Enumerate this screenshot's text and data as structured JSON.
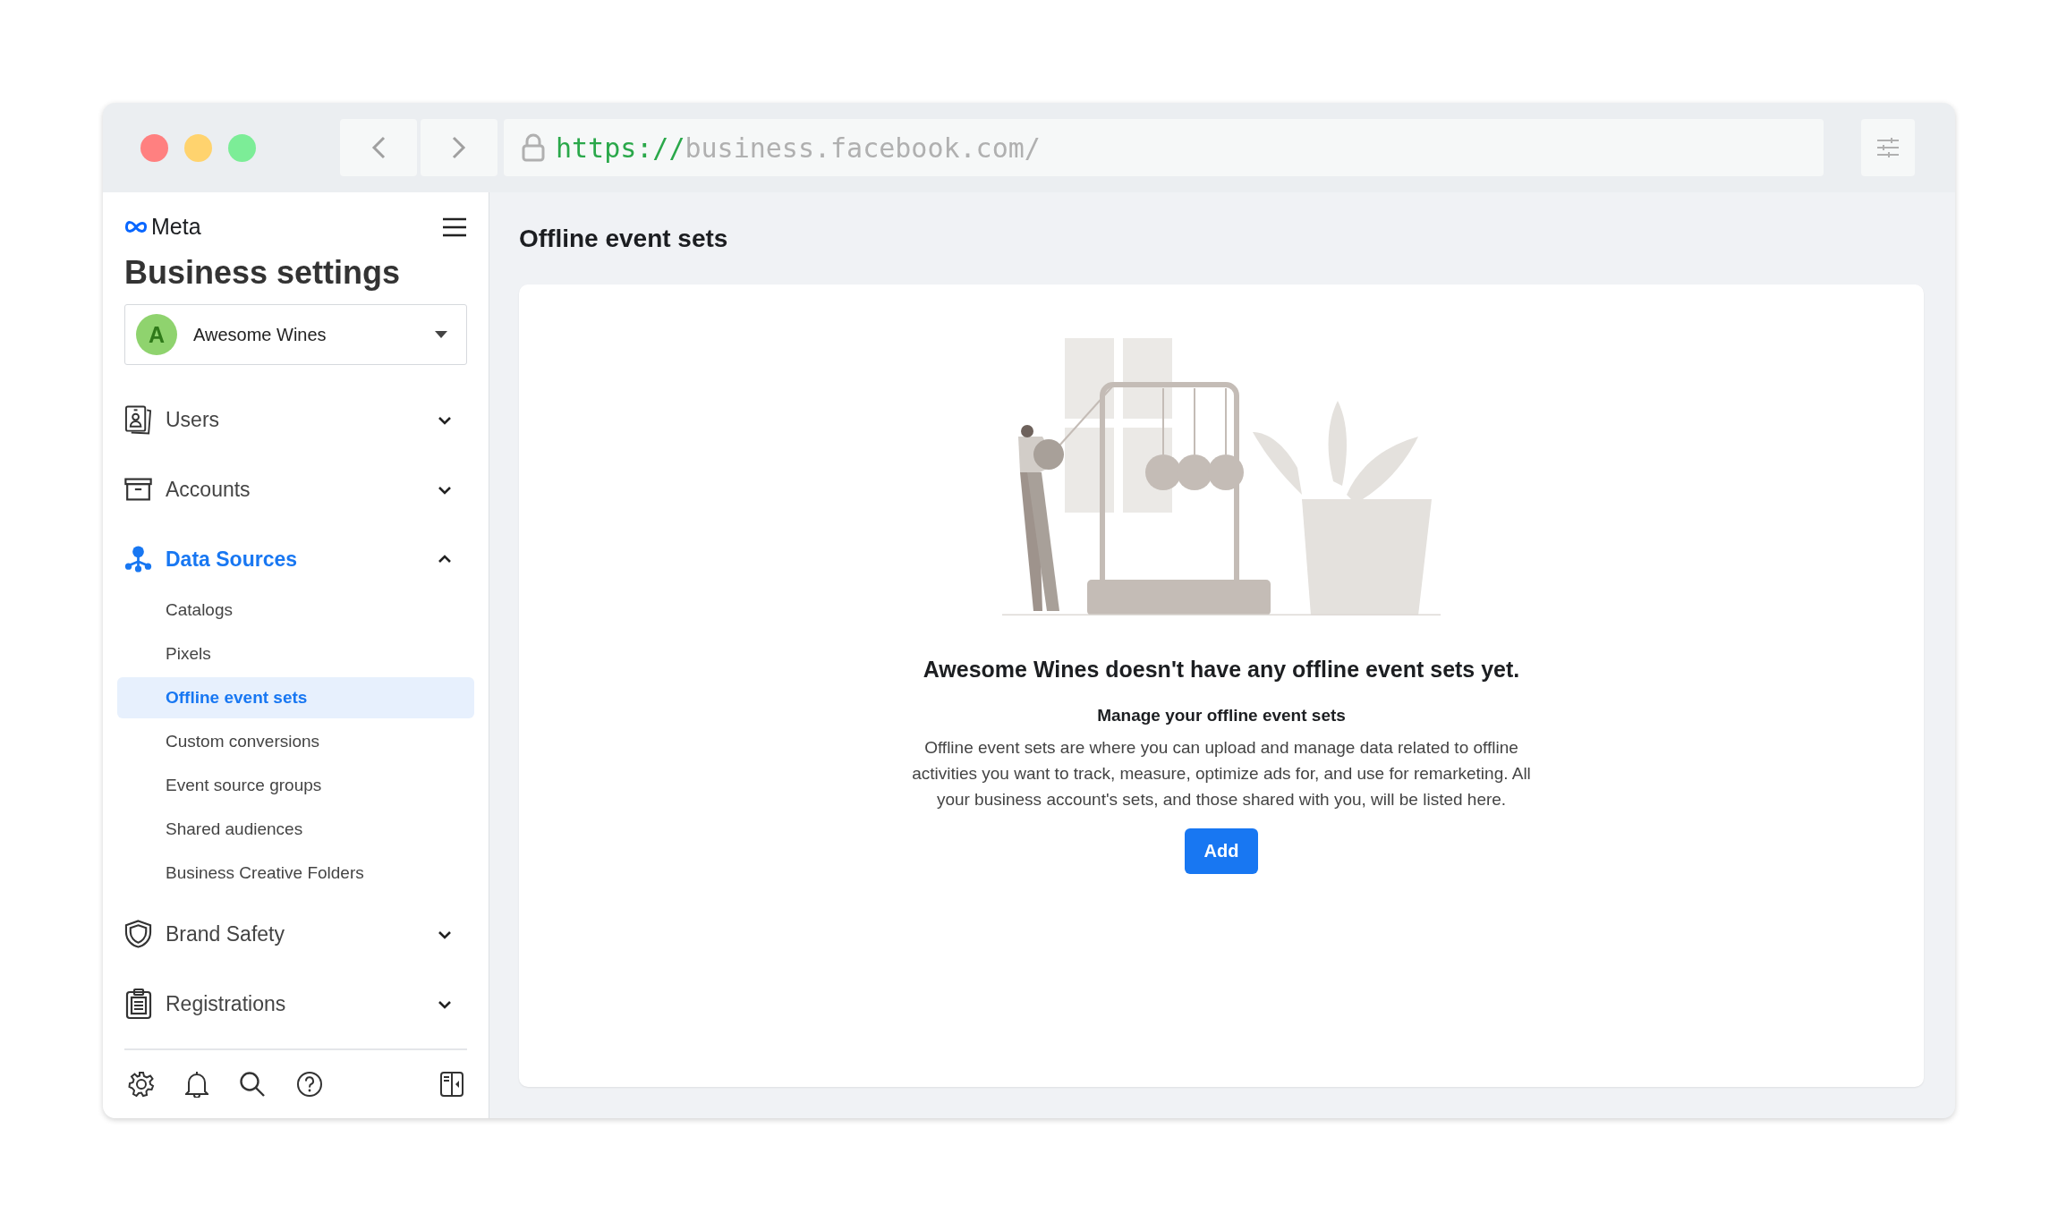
{
  "browser": {
    "url": {
      "scheme": "https://",
      "rest": "business.facebook.com/"
    }
  },
  "sidebar": {
    "brand": "Meta",
    "title": "Business settings",
    "account": {
      "initial": "A",
      "name": "Awesome Wines"
    },
    "sections": [
      {
        "label": "Users",
        "expanded": false,
        "active": false
      },
      {
        "label": "Accounts",
        "expanded": false,
        "active": false
      },
      {
        "label": "Data Sources",
        "expanded": true,
        "active": true,
        "children": [
          {
            "label": "Catalogs",
            "selected": false
          },
          {
            "label": "Pixels",
            "selected": false
          },
          {
            "label": "Offline event sets",
            "selected": true
          },
          {
            "label": "Custom conversions",
            "selected": false
          },
          {
            "label": "Event source groups",
            "selected": false
          },
          {
            "label": "Shared audiences",
            "selected": false
          },
          {
            "label": "Business Creative Folders",
            "selected": false
          }
        ]
      },
      {
        "label": "Brand Safety",
        "expanded": false,
        "active": false
      },
      {
        "label": "Registrations",
        "expanded": false,
        "active": false
      }
    ]
  },
  "main": {
    "title": "Offline event sets",
    "empty_state": {
      "heading": "Awesome Wines doesn't have any offline event sets yet.",
      "subheading": "Manage your offline event sets",
      "body": "Offline event sets are where you can upload and manage data related to offline activities you want to track, measure, optimize ads for, and use for remarketing. All your business account's sets, and those shared with you, will be listed here.",
      "button": "Add"
    }
  }
}
